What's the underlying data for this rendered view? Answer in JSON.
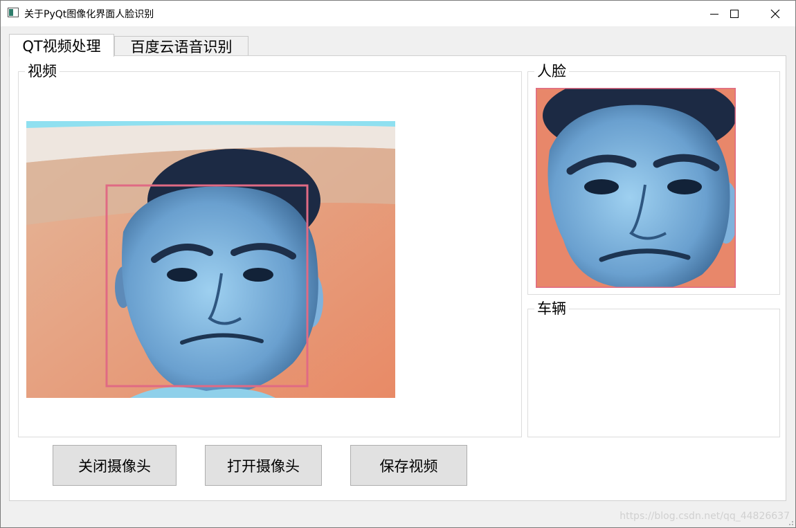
{
  "window": {
    "title": "关于PyQt图像化界面人脸识别",
    "icon": "app-window-icon",
    "controls": [
      "minimize-icon",
      "maximize-icon",
      "close-icon"
    ]
  },
  "tabs": [
    {
      "label": "QT视频处理",
      "active": true
    },
    {
      "label": "百度云语音识别",
      "active": false
    }
  ],
  "groups": {
    "video": {
      "title": "视频"
    },
    "face": {
      "title": "人脸"
    },
    "vehicle": {
      "title": "车辆"
    }
  },
  "buttons": {
    "close_camera": "关闭摄像头",
    "open_camera": "打开摄像头",
    "save_video": "保存视频"
  },
  "watermark": "https://blog.csdn.net/qq_44826637",
  "colors": {
    "detection_box": "#e06a84",
    "photo_background": "#e7916e",
    "face_tint": "#6ea8d8"
  }
}
